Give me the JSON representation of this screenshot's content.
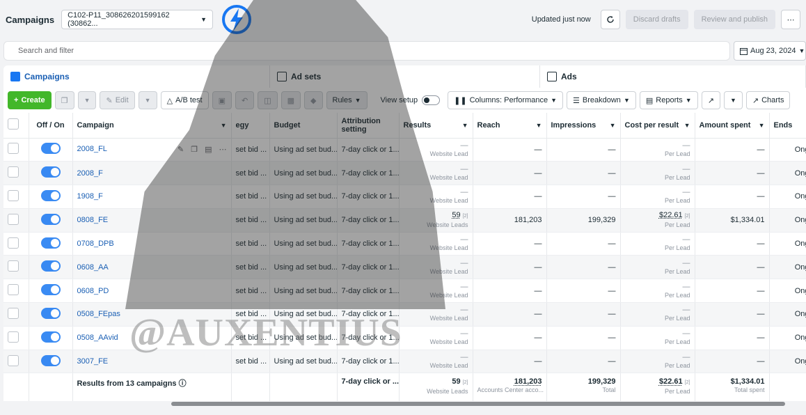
{
  "topbar": {
    "title": "Campaigns",
    "account": "C102-P11_308626201599162 (30862...",
    "updated": "Updated just now",
    "discard": "Discard drafts",
    "review": "Review and publish",
    "more": "⋯"
  },
  "search": {
    "placeholder": "Search and filter"
  },
  "date": {
    "label": "Aug 23, 2024"
  },
  "tabs": [
    {
      "label": "Campaigns"
    },
    {
      "label": "Ad sets"
    },
    {
      "label": "Ads"
    }
  ],
  "toolbar": {
    "create": "Create",
    "edit": "Edit",
    "ab_test": "A/B test",
    "rules": "Rules",
    "view_setup": "View setup",
    "columns": "Columns: Performance",
    "breakdown": "Breakdown",
    "reports": "Reports",
    "charts": "Charts"
  },
  "table": {
    "headers": {
      "off_on": "Off / On",
      "campaign": "Campaign",
      "strategy": "egy",
      "budget": "Budget",
      "attribution": "Attribution setting",
      "results": "Results",
      "reach": "Reach",
      "impressions": "Impressions",
      "cost": "Cost per result",
      "spent": "Amount spent",
      "ends": "Ends"
    },
    "rows": [
      {
        "name": "2008_FL",
        "strategy": "set bid ...",
        "budget": "Using ad set bud...",
        "attribution": "7-day click or 1...",
        "results": "—",
        "results_sub": "Website Lead",
        "reach": "—",
        "impressions": "—",
        "cost": "—",
        "cost_sub": "Per Lead",
        "spent": "—",
        "ends": "Ong"
      },
      {
        "name": "2008_F",
        "strategy": "set bid ...",
        "budget": "Using ad set bud...",
        "attribution": "7-day click or 1...",
        "results": "—",
        "results_sub": "Website Lead",
        "reach": "—",
        "impressions": "—",
        "cost": "—",
        "cost_sub": "Per Lead",
        "spent": "—",
        "ends": "Ong"
      },
      {
        "name": "1908_F",
        "strategy": "set bid ...",
        "budget": "Using ad set bud...",
        "attribution": "7-day click or 1...",
        "results": "—",
        "results_sub": "Website Lead",
        "reach": "—",
        "impressions": "—",
        "cost": "—",
        "cost_sub": "Per Lead",
        "spent": "—",
        "ends": "Ong"
      },
      {
        "name": "0808_FE",
        "strategy": "set bid ...",
        "budget": "Using ad set bud...",
        "attribution": "7-day click or 1...",
        "results": "59",
        "results_sup": "[2]",
        "results_sub": "Website Leads",
        "reach": "181,203",
        "impressions": "199,329",
        "cost": "$22.61",
        "cost_sup": "[2]",
        "cost_sub": "Per Lead",
        "spent": "$1,334.01",
        "ends": "Ong"
      },
      {
        "name": "0708_DPB",
        "strategy": "set bid ...",
        "budget": "Using ad set bud...",
        "attribution": "7-day click or 1...",
        "results": "—",
        "results_sub": "Website Lead",
        "reach": "—",
        "impressions": "—",
        "cost": "—",
        "cost_sub": "Per Lead",
        "spent": "—",
        "ends": "Ong"
      },
      {
        "name": "0608_AA",
        "strategy": "set bid ...",
        "budget": "Using ad set bud...",
        "attribution": "7-day click or 1...",
        "results": "—",
        "results_sub": "Website Lead",
        "reach": "—",
        "impressions": "—",
        "cost": "—",
        "cost_sub": "Per Lead",
        "spent": "—",
        "ends": "Ong"
      },
      {
        "name": "0608_PD",
        "strategy": "set bid ...",
        "budget": "Using ad set bud...",
        "attribution": "7-day click or 1...",
        "results": "—",
        "results_sub": "Website Lead",
        "reach": "—",
        "impressions": "—",
        "cost": "—",
        "cost_sub": "Per Lead",
        "spent": "—",
        "ends": "Ong"
      },
      {
        "name": "0508_FEpas",
        "strategy": "set bid ...",
        "budget": "Using ad set bud...",
        "attribution": "7-day click or 1...",
        "results": "—",
        "results_sub": "Website Lead",
        "reach": "—",
        "impressions": "—",
        "cost": "—",
        "cost_sub": "Per Lead",
        "spent": "—",
        "ends": "Ong"
      },
      {
        "name": "0508_AAvid",
        "strategy": "set bid ...",
        "budget": "Using ad set bud...",
        "attribution": "7-day click or 1...",
        "results": "—",
        "results_sub": "Website Lead",
        "reach": "—",
        "impressions": "—",
        "cost": "—",
        "cost_sub": "Per Lead",
        "spent": "—",
        "ends": "Ong"
      },
      {
        "name": "3007_FE",
        "strategy": "set bid ...",
        "budget": "Using ad set bud...",
        "attribution": "7-day click or 1...",
        "results": "—",
        "results_sub": "Website Lead",
        "reach": "—",
        "impressions": "—",
        "cost": "—",
        "cost_sub": "Per Lead",
        "spent": "—",
        "ends": "Ong"
      }
    ],
    "footer": {
      "label": "Results from 13 campaigns",
      "attribution": "7-day click or ...",
      "results": "59",
      "results_sup": "[2]",
      "results_sub": "Website Leads",
      "reach": "181,203",
      "reach_sub": "Accounts Center acco...",
      "impressions": "199,329",
      "impressions_sub": "Total",
      "cost": "$22.61",
      "cost_sup": "[2]",
      "cost_sub": "Per Lead",
      "spent": "$1,334.01",
      "spent_sub": "Total spent"
    }
  },
  "watermark": "@AUXENTIUS",
  "colors": {
    "accent": "#1877f2",
    "create": "#42b72a",
    "link": "#1a5fb4"
  }
}
